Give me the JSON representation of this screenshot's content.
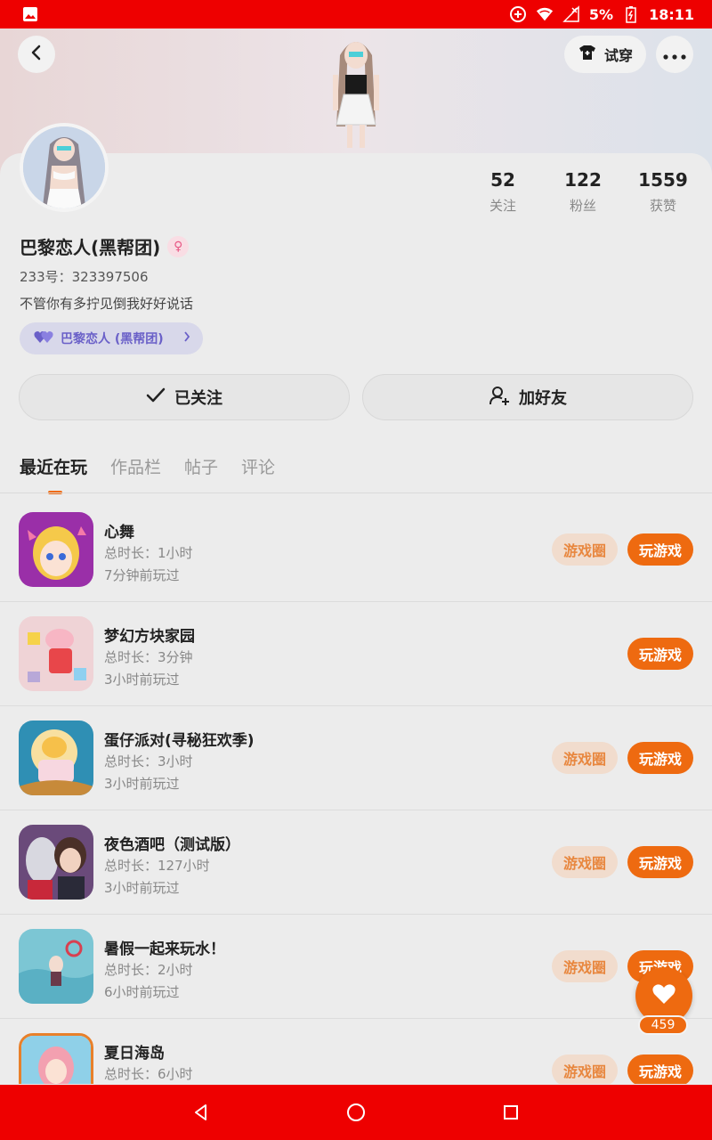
{
  "status_bar": {
    "battery": "5%",
    "time": "18:11",
    "icons": [
      "image-icon",
      "sync-icon",
      "wifi-icon",
      "no-signal-icon",
      "battery-charging-icon"
    ]
  },
  "header": {
    "back_icon": "back-arrow-icon",
    "tryon_label": "试穿",
    "tryon_icon": "shirt-icon",
    "more_icon": "more-icon"
  },
  "profile": {
    "name": "巴黎恋人(黑帮团)",
    "gender": "female",
    "id_text": "233号：323397506",
    "bio": "不管你有多拧见倒我好好说话",
    "group_tag": "巴黎恋人 (黑帮团)"
  },
  "stats": [
    {
      "value": "52",
      "label": "关注"
    },
    {
      "value": "122",
      "label": "粉丝"
    },
    {
      "value": "1559",
      "label": "获赞"
    }
  ],
  "actions": {
    "follow_label": "已关注",
    "add_friend_label": "加好友"
  },
  "tabs": [
    "最近在玩",
    "作品栏",
    "帖子",
    "评论"
  ],
  "games": [
    {
      "name": "心舞",
      "duration": "总时长：1小时",
      "last_played": "7分钟前玩过",
      "has_circle": true
    },
    {
      "name": "梦幻方块家园",
      "duration": "总时长：3分钟",
      "last_played": "3小时前玩过",
      "has_circle": false
    },
    {
      "name": "蛋仔派对(寻秘狂欢季)",
      "duration": "总时长：3小时",
      "last_played": "3小时前玩过",
      "has_circle": true
    },
    {
      "name": "夜色酒吧（测试版）",
      "duration": "总时长：127小时",
      "last_played": "3小时前玩过",
      "has_circle": true
    },
    {
      "name": "暑假一起来玩水！",
      "duration": "总时长：2小时",
      "last_played": "6小时前玩过",
      "has_circle": true
    },
    {
      "name": "夏日海岛",
      "duration": "总时长：6小时",
      "last_played": "",
      "has_circle": true
    }
  ],
  "game_buttons": {
    "circle_label": "游戏圈",
    "play_label": "玩游戏"
  },
  "like_float": {
    "count": "459",
    "icon": "heart-icon"
  },
  "colors": {
    "accent": "#ee6a10",
    "status_bar": "#ee0000",
    "circle_button_bg": "#f1dccd"
  }
}
